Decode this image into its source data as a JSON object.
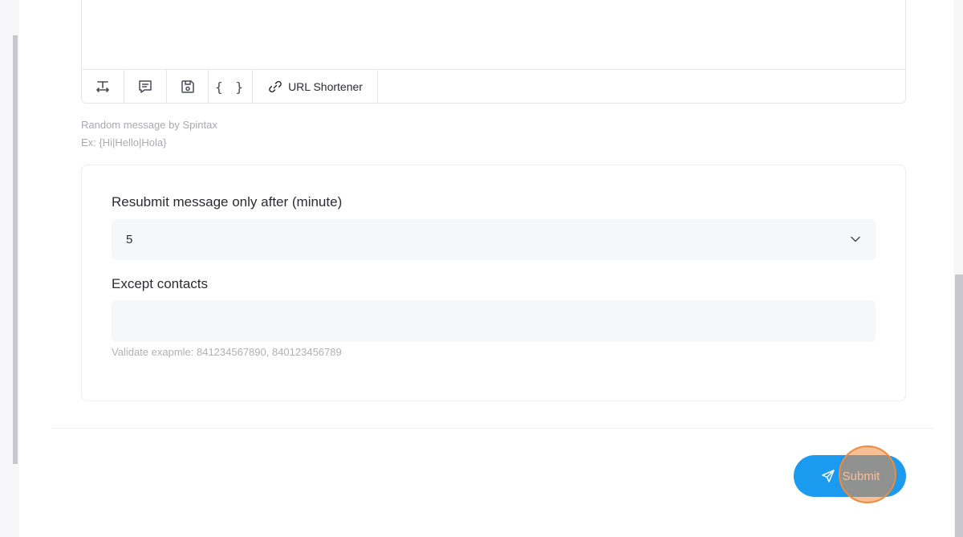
{
  "toolbar": {
    "tools": [
      {
        "icon": "text-resize-icon"
      },
      {
        "icon": "comment-icon"
      },
      {
        "icon": "save-icon"
      },
      {
        "icon": "spintax-braces-icon",
        "glyph": "{ }"
      },
      {
        "icon": "link-icon",
        "label": "URL Shortener"
      }
    ]
  },
  "hints": {
    "spintax_title": "Random message by Spintax",
    "spintax_example": "Ex: {Hi|Hello|Hola}"
  },
  "resubmit": {
    "label": "Resubmit message only after (minute)",
    "selected_value": "5"
  },
  "except_contacts": {
    "label": "Except contacts",
    "value": "",
    "validate_hint": "Validate exapmle: 841234567890, 840123456789"
  },
  "actions": {
    "submit_label": "Submit"
  },
  "colors": {
    "primary": "#1a9bf0",
    "click_indicator": "#f08a3e"
  }
}
